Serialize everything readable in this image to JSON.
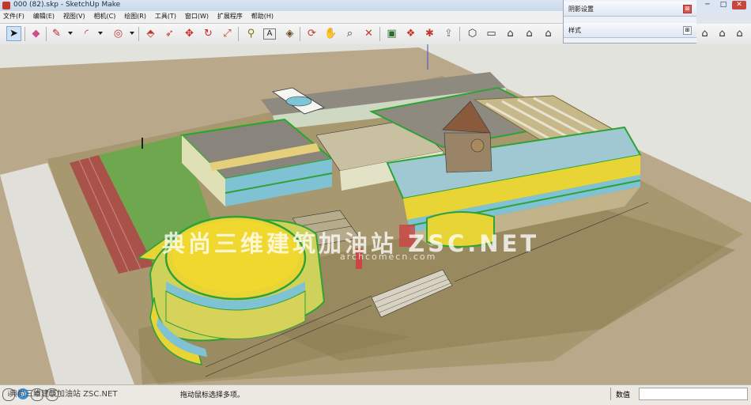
{
  "window": {
    "title": "000 (82).skp - SketchUp Make",
    "controls": {
      "minimize": "─",
      "maximize": "□",
      "close": "✕"
    }
  },
  "menu": [
    "文件(F)",
    "编辑(E)",
    "视图(V)",
    "相机(C)",
    "绘图(R)",
    "工具(T)",
    "窗口(W)",
    "扩展程序",
    "帮助(H)"
  ],
  "toolbar": {
    "tools": [
      {
        "name": "select-tool",
        "glyph": "➤",
        "active": true
      },
      {
        "name": "eraser-tool",
        "glyph": "◆"
      },
      {
        "name": "line-tool",
        "glyph": "✎"
      },
      {
        "name": "arc-tool",
        "glyph": "◜"
      },
      {
        "name": "shape-tool",
        "glyph": "◎"
      },
      {
        "name": "push-pull-tool",
        "glyph": "⬘"
      },
      {
        "name": "follow-me-tool",
        "glyph": "➶"
      },
      {
        "name": "move-tool",
        "glyph": "✥"
      },
      {
        "name": "rotate-tool",
        "glyph": "↻"
      },
      {
        "name": "scale-tool",
        "glyph": "⤢"
      },
      {
        "name": "tape-measure-tool",
        "glyph": "⚲"
      },
      {
        "name": "text-tool",
        "glyph": "A"
      },
      {
        "name": "paint-bucket-tool",
        "glyph": "◈"
      },
      {
        "name": "orbit-tool",
        "glyph": "⟳"
      },
      {
        "name": "pan-tool",
        "glyph": "✋"
      },
      {
        "name": "zoom-tool",
        "glyph": "⌕"
      },
      {
        "name": "zoom-extents-tool",
        "glyph": "✕"
      },
      {
        "name": "warehouse-tool",
        "glyph": "▣"
      },
      {
        "name": "components-tool",
        "glyph": "❖"
      },
      {
        "name": "extension-warehouse-tool",
        "glyph": "✱"
      },
      {
        "name": "share-model-tool",
        "glyph": "⇪"
      },
      {
        "name": "iso-view",
        "glyph": "⬡"
      },
      {
        "name": "top-view",
        "glyph": "▭"
      },
      {
        "name": "front-view",
        "glyph": "⌂"
      },
      {
        "name": "right-view",
        "glyph": "⌂"
      },
      {
        "name": "back-view",
        "glyph": "⌂"
      },
      {
        "name": "left-view",
        "glyph": "⌂"
      }
    ]
  },
  "tray": {
    "panels": [
      {
        "title": "阴影设置",
        "button": "⊠"
      },
      {
        "title": "样式",
        "button": "⊞"
      }
    ]
  },
  "watermark": {
    "cn": "典尚三维建筑加油站 ZSC.NET",
    "url": "archcomecn.com",
    "status_overlay": "典尚三维建筑加油站 ZSC.NET"
  },
  "status": {
    "icons": [
      "info-icon",
      "geo-icon",
      "credits-icon",
      "user-icon"
    ],
    "hint": "拖动鼠标选择多项。",
    "measurements_label": "数值",
    "measurements_value": ""
  },
  "colors": {
    "sky": "#e2e4dc",
    "ground": "#b8a988",
    "site": "#a99a74",
    "lawn": "#6fa74e",
    "red_strip": "#a9524a",
    "roof_yellow": "#e9d436",
    "accent_green": "#2fa236",
    "glass_blue": "#8fc8d8",
    "roof_gray": "#8f8a7f"
  }
}
